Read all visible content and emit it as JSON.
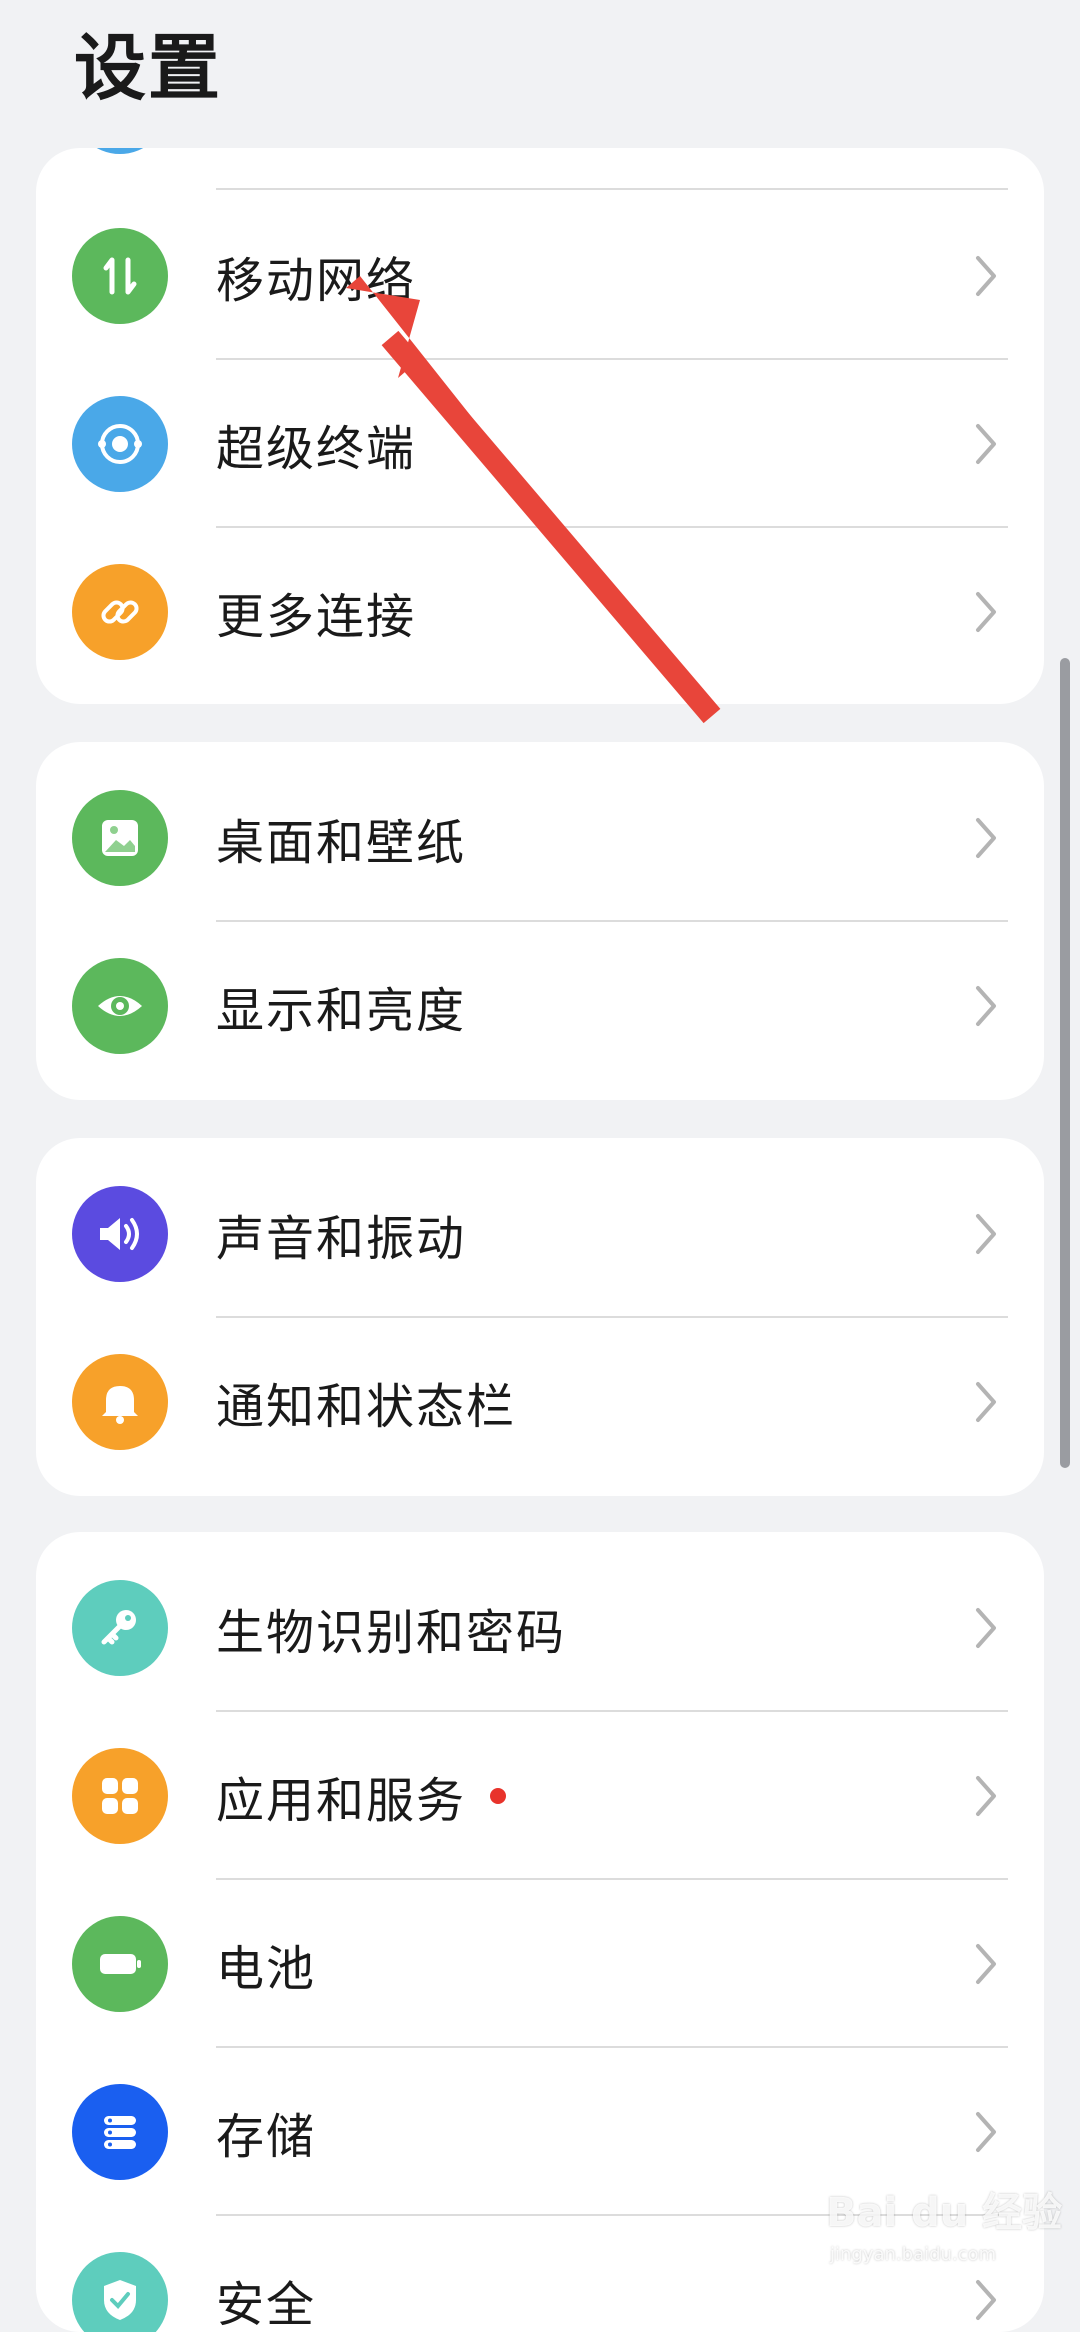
{
  "header": {
    "title": "设置"
  },
  "groups": [
    {
      "items": [
        {
          "label": "移动网络",
          "icon": "mobile-data-icon",
          "color": "#5cb85c"
        },
        {
          "label": "超级终端",
          "icon": "super-device-icon",
          "color": "#4aa8e8"
        },
        {
          "label": "更多连接",
          "icon": "link-icon",
          "color": "#f7a12a"
        }
      ]
    },
    {
      "items": [
        {
          "label": "桌面和壁纸",
          "icon": "wallpaper-icon",
          "color": "#5cb85c"
        },
        {
          "label": "显示和亮度",
          "icon": "eye-icon",
          "color": "#5cb85c"
        }
      ]
    },
    {
      "items": [
        {
          "label": "声音和振动",
          "icon": "speaker-icon",
          "color": "#5b4be0"
        },
        {
          "label": "通知和状态栏",
          "icon": "bell-icon",
          "color": "#f7a12a"
        }
      ]
    },
    {
      "items": [
        {
          "label": "生物识别和密码",
          "icon": "key-icon",
          "color": "#5ecdbd"
        },
        {
          "label": "应用和服务",
          "icon": "apps-icon",
          "color": "#f7a12a",
          "badge": true
        },
        {
          "label": "电池",
          "icon": "battery-icon",
          "color": "#5cb85c"
        },
        {
          "label": "存储",
          "icon": "storage-icon",
          "color": "#1a5ff0"
        },
        {
          "label": "安全",
          "icon": "shield-icon",
          "color": "#5ecdbd"
        }
      ]
    }
  ],
  "annotation": {
    "color": "#e8453a"
  },
  "watermark": {
    "text": "Bai du 经验",
    "sub": "jingyan.baidu.com"
  }
}
